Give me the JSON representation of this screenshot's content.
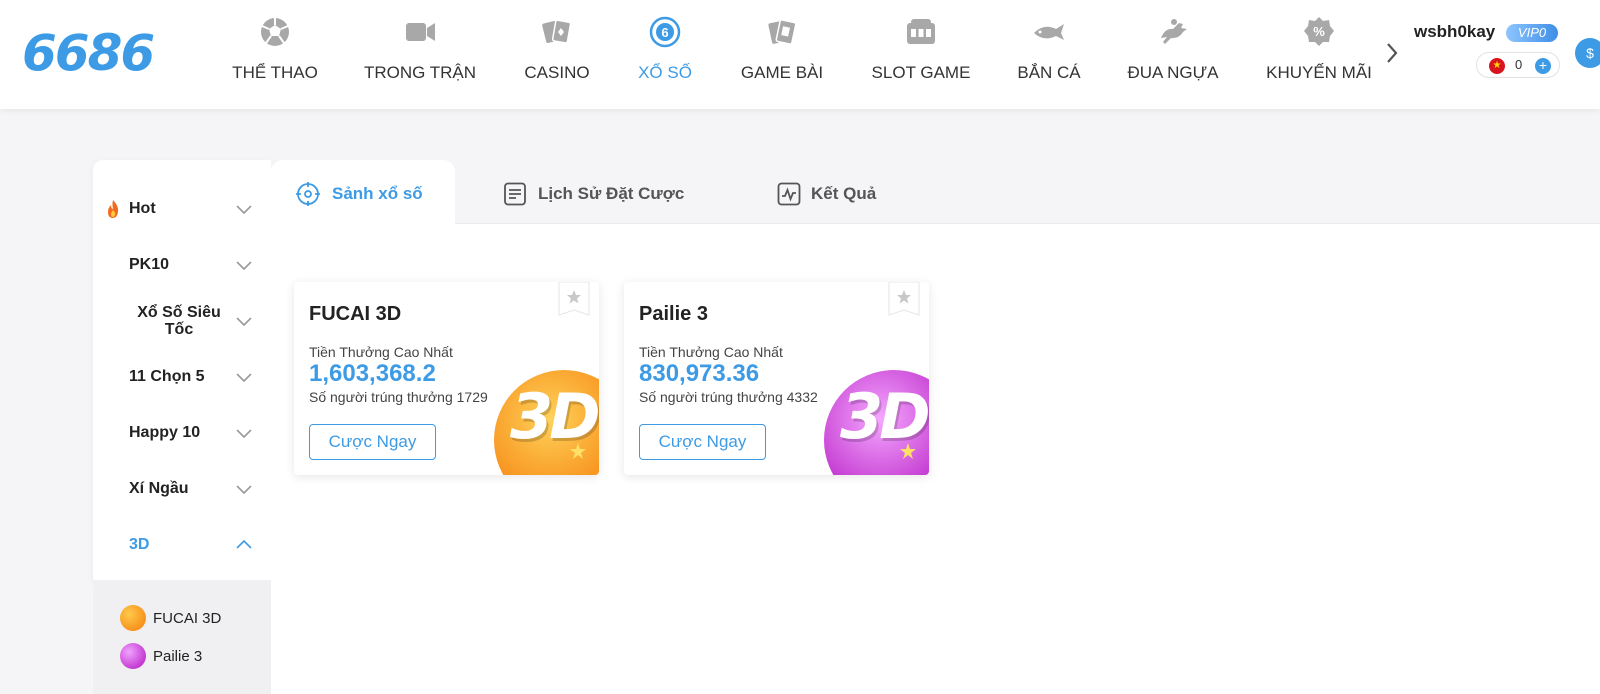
{
  "header": {
    "logo": "6686",
    "nav": [
      {
        "label": "THỂ THAO",
        "icon": "soccer-ball-icon"
      },
      {
        "label": "TRONG TRẬN",
        "icon": "video-camera-icon"
      },
      {
        "label": "CASINO",
        "icon": "playing-cards-icon"
      },
      {
        "label": "XỔ SỐ",
        "icon": "lottery-ball-icon",
        "active": true
      },
      {
        "label": "GAME BÀI",
        "icon": "card-game-icon"
      },
      {
        "label": "SLOT GAME",
        "icon": "slot-machine-icon"
      },
      {
        "label": "BẮN CÁ",
        "icon": "fish-icon"
      },
      {
        "label": "ĐUA NGỰA",
        "icon": "horse-racing-icon"
      },
      {
        "label": "KHUYẾN MÃI",
        "icon": "percent-badge-icon"
      }
    ],
    "user": {
      "name": "wsbh0kay",
      "vip": "VIP0",
      "balance": "0"
    }
  },
  "sidebar": {
    "items": [
      {
        "label": "Hot",
        "expanded": false
      },
      {
        "label": "PK10",
        "expanded": false
      },
      {
        "label": "Xổ Số Siêu Tốc",
        "expanded": false
      },
      {
        "label": "11 Chọn 5",
        "expanded": false
      },
      {
        "label": "Happy 10",
        "expanded": false
      },
      {
        "label": "Xí Ngầu",
        "expanded": false
      },
      {
        "label": "3D",
        "expanded": true,
        "active": true
      }
    ],
    "subitems": [
      {
        "label": "FUCAI 3D"
      },
      {
        "label": "Pailie 3"
      }
    ]
  },
  "tabs": [
    {
      "label": "Sảnh xổ số",
      "icon": "target-icon",
      "active": true
    },
    {
      "label": "Lịch Sử Đặt Cược",
      "icon": "document-list-icon"
    },
    {
      "label": "Kết Quả",
      "icon": "chart-line-icon"
    }
  ],
  "cards": [
    {
      "title": "FUCAI 3D",
      "prize_label": "Tiền Thưởng Cao Nhất",
      "prize": "1,603,368.2",
      "winners_text": "Số người trúng thưởng 1729",
      "button": "Cược Ngay",
      "art_text": "3D",
      "art_color": "#f7931e"
    },
    {
      "title": "Pailie 3",
      "prize_label": "Tiền Thưởng Cao Nhất",
      "prize": "830,973.36",
      "winners_text": "Số người trúng thưởng 4332",
      "button": "Cược Ngay",
      "art_text": "3D",
      "art_color": "#c43bd1"
    }
  ],
  "colors": {
    "accent": "#3d9be6",
    "orange": "#f7931e",
    "purple": "#c43bd1"
  }
}
